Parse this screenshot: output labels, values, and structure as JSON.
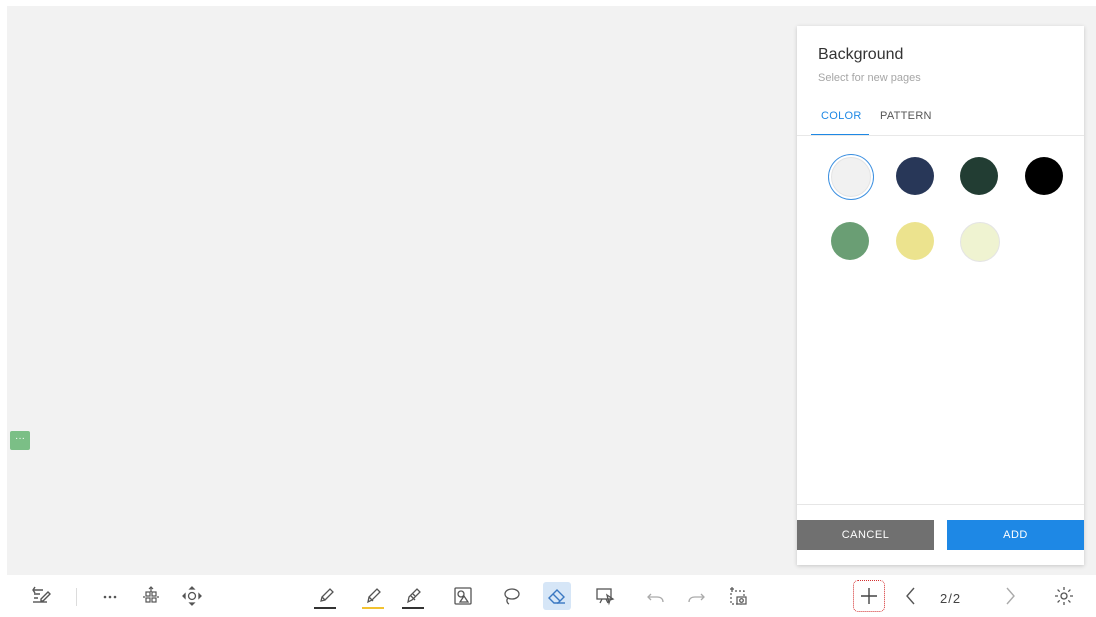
{
  "panel": {
    "title": "Background",
    "subtitle": "Select for new pages",
    "tabs": [
      {
        "label": "COLOR",
        "active": true
      },
      {
        "label": "PATTERN",
        "active": false
      }
    ],
    "colors": [
      {
        "name": "light-gray",
        "hex": "#f1f1f1",
        "selected": true
      },
      {
        "name": "navy",
        "hex": "#283758",
        "selected": false
      },
      {
        "name": "dark-green",
        "hex": "#223d33",
        "selected": false
      },
      {
        "name": "black",
        "hex": "#000000",
        "selected": false
      },
      {
        "name": "green",
        "hex": "#6a9e74",
        "selected": false
      },
      {
        "name": "yellow",
        "hex": "#ece38e",
        "selected": false
      },
      {
        "name": "pale-yellow",
        "hex": "#eff3d1",
        "selected": false
      }
    ],
    "cancel_label": "CANCEL",
    "add_label": "ADD"
  },
  "side_handle": "···",
  "toolbar": {
    "page_indicator": "2/2",
    "tools": [
      "annotate-icon",
      "more-icon",
      "pan-icon",
      "move-icon",
      "pen-icon",
      "highlighter-icon",
      "marker-icon",
      "shape-icon",
      "lasso-icon",
      "eraser-icon",
      "present-icon",
      "undo-icon",
      "redo-icon",
      "screenshot-icon",
      "add-page-icon",
      "prev-page-icon",
      "next-page-icon",
      "settings-icon"
    ]
  },
  "colors": {
    "accent": "#1e88e5",
    "canvas": "#f2f2f2",
    "cancel": "#707070"
  }
}
